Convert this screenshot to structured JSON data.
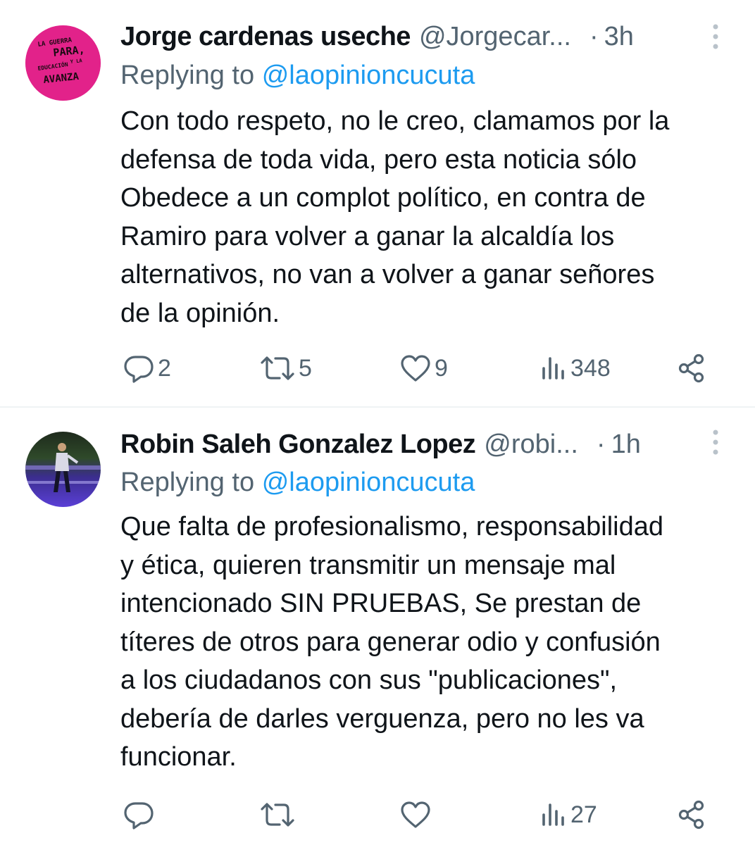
{
  "tweets": [
    {
      "author_name": "Jorge cardenas useche",
      "handle": "@Jorgecar...",
      "separator": "·",
      "time": "3h",
      "replying_label": "Replying to",
      "replying_to": "@laopinioncucuta",
      "text": "Con todo respeto, no le creo, clamamos por la\ndefensa de toda vida, pero esta noticia sólo\nObedece a un complot político, en contra de\nRamiro para volver a ganar la alcaldía los\nalternativos, no van a volver a ganar señores\nde la opinión.",
      "avatar_text": {
        "line1": "LA GUERRA",
        "line2": "PARA,",
        "line3": "Y LA",
        "line4": "EDUCACIÓN",
        "line5": "AVANZA"
      },
      "avatar_color": "#e8278f",
      "stats": {
        "replies": "2",
        "retweets": "5",
        "likes": "9",
        "views": "348"
      }
    },
    {
      "author_name": "Robin Saleh Gonzalez Lopez",
      "handle": "@robi...",
      "separator": "·",
      "time": "1h",
      "replying_label": "Replying to",
      "replying_to": "@laopinioncucuta",
      "text": "Que falta de profesionalismo, responsabilidad\ny ética, quieren transmitir un mensaje mal\nintencionado SIN PRUEBAS, Se prestan de\ntíteres de otros para generar odio y confusión\na los ciudadanos con sus \"publicaciones\",\ndebería de darles verguenza, pero no les va\nfuncionar.",
      "avatar_color": "#3a2b8c",
      "stats": {
        "replies": "",
        "retweets": "",
        "likes": "",
        "views": "27"
      }
    }
  ],
  "colors": {
    "text": "#0f1419",
    "secondary": "#536471",
    "link": "#1d9bf0",
    "divider": "#eff3f4"
  },
  "icons": {
    "reply": "reply-icon",
    "retweet": "retweet-icon",
    "like": "heart-icon",
    "views": "views-icon",
    "share": "share-icon",
    "more": "more-vertical-icon"
  }
}
